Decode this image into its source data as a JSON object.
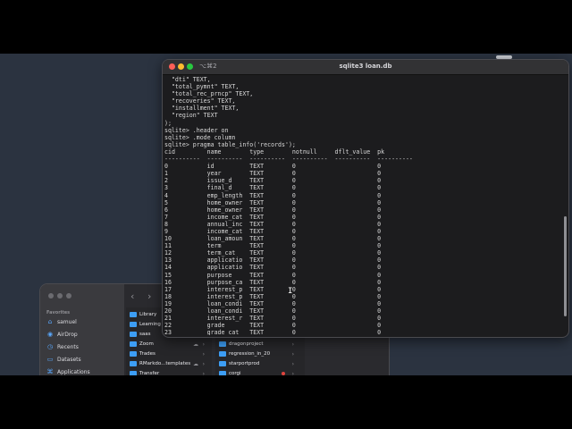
{
  "terminal": {
    "shortcut": "⌥⌘2",
    "title": "sqlite3 loan.db",
    "lines": [
      "  \"dti\" TEXT,",
      "  \"total_pymnt\" TEXT,",
      "  \"total_rec_prncp\" TEXT,",
      "  \"recoveries\" TEXT,",
      "  \"installment\" TEXT,",
      "  \"region\" TEXT",
      ");",
      "sqlite> .header on",
      "sqlite> .mode column",
      "sqlite> pragma table_info('records');"
    ],
    "columns": [
      "cid",
      "name",
      "type",
      "notnull",
      "dflt_value",
      "pk"
    ],
    "separators": [
      "----------",
      "----------",
      "----------",
      "----------",
      "----------",
      "----------"
    ],
    "rows": [
      [
        "0",
        "id",
        "TEXT",
        "0",
        "",
        "0"
      ],
      [
        "1",
        "year",
        "TEXT",
        "0",
        "",
        "0"
      ],
      [
        "2",
        "issue_d",
        "TEXT",
        "0",
        "",
        "0"
      ],
      [
        "3",
        "final_d",
        "TEXT",
        "0",
        "",
        "0"
      ],
      [
        "4",
        "emp_length",
        "TEXT",
        "0",
        "",
        "0"
      ],
      [
        "5",
        "home_owner",
        "TEXT",
        "0",
        "",
        "0"
      ],
      [
        "6",
        "home_owner",
        "TEXT",
        "0",
        "",
        "0"
      ],
      [
        "7",
        "income_cat",
        "TEXT",
        "0",
        "",
        "0"
      ],
      [
        "8",
        "annual_inc",
        "TEXT",
        "0",
        "",
        "0"
      ],
      [
        "9",
        "income_cat",
        "TEXT",
        "0",
        "",
        "0"
      ],
      [
        "10",
        "loan_amoun",
        "TEXT",
        "0",
        "",
        "0"
      ],
      [
        "11",
        "term",
        "TEXT",
        "0",
        "",
        "0"
      ],
      [
        "12",
        "term_cat",
        "TEXT",
        "0",
        "",
        "0"
      ],
      [
        "13",
        "applicatio",
        "TEXT",
        "0",
        "",
        "0"
      ],
      [
        "14",
        "applicatio",
        "TEXT",
        "0",
        "",
        "0"
      ],
      [
        "15",
        "purpose",
        "TEXT",
        "0",
        "",
        "0"
      ],
      [
        "16",
        "purpose_ca",
        "TEXT",
        "0",
        "",
        "0"
      ],
      [
        "17",
        "interest_p",
        "TEXT",
        "0",
        "",
        "0"
      ],
      [
        "18",
        "interest_p",
        "TEXT",
        "0",
        "",
        "0"
      ],
      [
        "19",
        "loan_condi",
        "TEXT",
        "0",
        "",
        "0"
      ],
      [
        "20",
        "loan_condi",
        "TEXT",
        "0",
        "",
        "0"
      ],
      [
        "21",
        "interest_r",
        "TEXT",
        "0",
        "",
        "0"
      ],
      [
        "22",
        "grade",
        "TEXT",
        "0",
        "",
        "0"
      ],
      [
        "23",
        "grade_cat",
        "TEXT",
        "0",
        "",
        "0"
      ]
    ]
  },
  "finder": {
    "favorites_title": "Favorites",
    "favorites": [
      {
        "label": "samuel",
        "icon": "home-icon"
      },
      {
        "label": "AirDrop",
        "icon": "airdrop-icon"
      },
      {
        "label": "Recents",
        "icon": "clock-icon"
      },
      {
        "label": "Datasets",
        "icon": "folder-icon"
      },
      {
        "label": "Applications",
        "icon": "applications-icon"
      }
    ],
    "column1": [
      {
        "label": "Library",
        "chevron": false
      },
      {
        "label": "Learning",
        "chevron": false
      },
      {
        "label": "saas",
        "chevron": false
      },
      {
        "label": "Zoom",
        "chevron": true,
        "cloud": true
      },
      {
        "label": "Trades",
        "chevron": true
      },
      {
        "label": "RMarkdo...templates",
        "chevron": true,
        "cloud": true
      },
      {
        "label": "Transfer",
        "chevron": true
      }
    ],
    "column2": [
      {
        "label": "dragonproject",
        "chevron": true
      },
      {
        "label": "regression_in_20",
        "chevron": true
      },
      {
        "label": "starportprod",
        "chevron": true
      },
      {
        "label": "corgi",
        "chevron": true,
        "tag": "#e0443e"
      }
    ]
  }
}
